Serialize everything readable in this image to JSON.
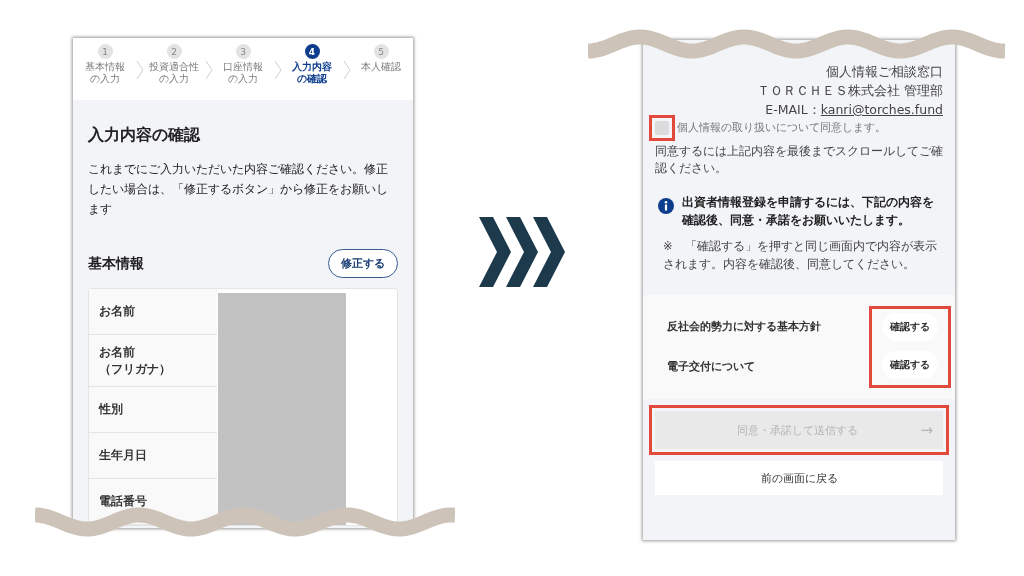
{
  "left_screen": {
    "steps": [
      {
        "number": "1",
        "lines": [
          "基本情報",
          "の入力"
        ],
        "selected": false
      },
      {
        "number": "2",
        "lines": [
          "投資適合性",
          "の入力"
        ],
        "selected": false
      },
      {
        "number": "3",
        "lines": [
          "口座情報",
          "の入力"
        ],
        "selected": false
      },
      {
        "number": "4",
        "lines": [
          "入力内容",
          "の確認"
        ],
        "selected": true
      },
      {
        "number": "5",
        "lines": [
          "本人確認"
        ],
        "selected": false
      }
    ],
    "title": "入力内容の確認",
    "intro": "これまでにご入力いただいた内容ご確認ください。修正したい場合は、「修正するボタン」から修正をお願いします",
    "section": {
      "heading": "基本情報",
      "edit_button": "修正する"
    },
    "fields": [
      {
        "lines": [
          "お名前"
        ]
      },
      {
        "lines": [
          "お名前",
          "（フリガナ）"
        ]
      },
      {
        "lines": [
          "性別"
        ]
      },
      {
        "lines": [
          "生年月日"
        ]
      },
      {
        "lines": [
          "電話番号"
        ]
      }
    ]
  },
  "right_screen": {
    "contact_lines": [
      "個人情報ご相談窓口",
      "ＴＯＲＣＨＥＳ株式会社 管理部"
    ],
    "email": {
      "prefix": "E-MAIL：",
      "link": "kanri@torches.fund"
    },
    "consent": {
      "label": "個人情報の取り扱いについて同意します。",
      "checked": false,
      "highlighted": true
    },
    "consent_note": "同意するには上記内容を最後までスクロールしてご確認ください。",
    "notice": "出資者情報登録を申請するには、下記の内容を確認後、同意・承諾をお願いいたします。",
    "notice_note": "※　「確認する」を押すと同じ画面内で内容が表示されます。内容を確認後、同意してください。",
    "documents": {
      "highlighted": true,
      "items": [
        {
          "title": "反社会的勢力に対する基本方針",
          "button": "確認する"
        },
        {
          "title": "電子交付について",
          "button": "確認する"
        }
      ]
    },
    "submit": {
      "label": "同意・承諾して送信する",
      "arrow": "→",
      "disabled": true,
      "highlighted": true
    },
    "back_button": "前の画面に戻る"
  }
}
